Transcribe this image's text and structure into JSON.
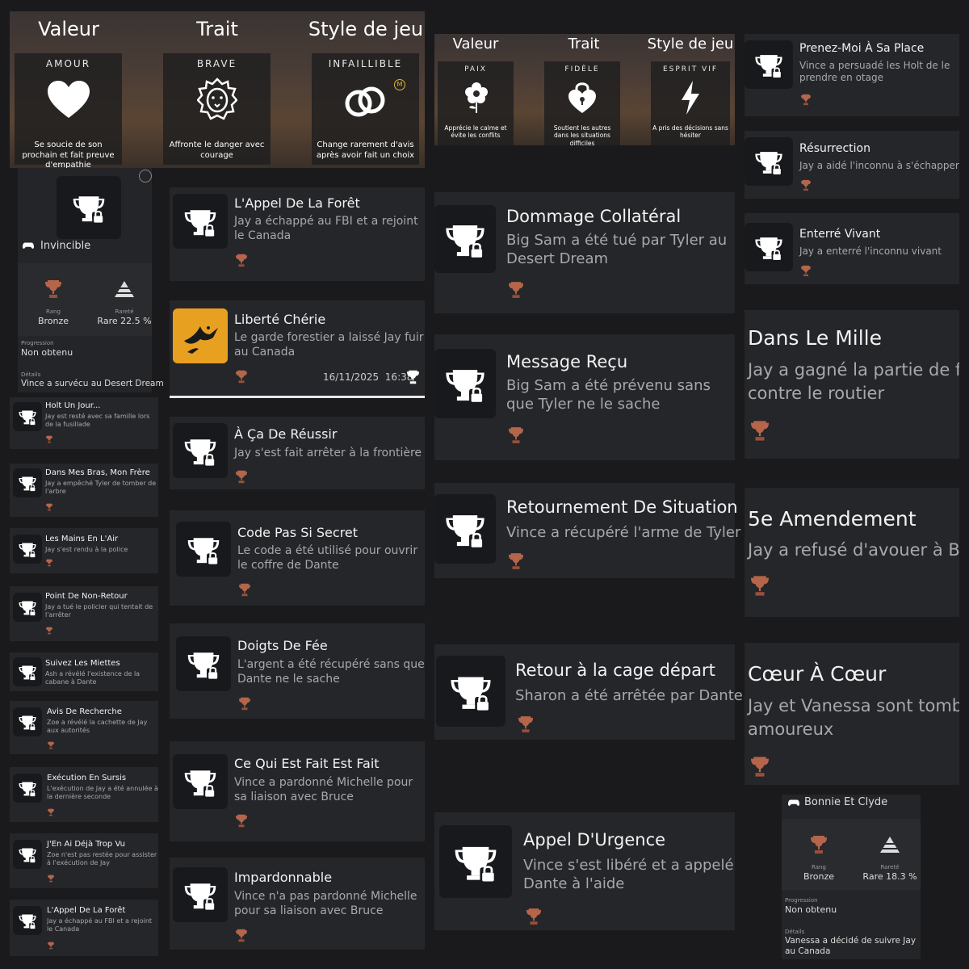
{
  "header1": {
    "cols": [
      "Valeur",
      "Trait",
      "Style de jeu"
    ],
    "boxes": [
      {
        "name": "AMOUR",
        "icon": "heart-icon",
        "desc": "Se soucie de son prochain et fait preuve d'empathie"
      },
      {
        "name": "BRAVE",
        "icon": "lion-icon",
        "desc": "Affronte le danger avec courage"
      },
      {
        "name": "INFAILLIBLE",
        "icon": "rings-icon",
        "badge": "M",
        "desc": "Change rarement d'avis après avoir fait un choix"
      }
    ]
  },
  "header2": {
    "cols": [
      "Valeur",
      "Trait",
      "Style de jeu"
    ],
    "boxes": [
      {
        "name": "PAIX",
        "icon": "flower-icon",
        "desc": "Apprécie le calme et évite les conflits"
      },
      {
        "name": "FIDÈLE",
        "icon": "lock-heart-icon",
        "desc": "Soutient les autres dans les situations difficiles"
      },
      {
        "name": "ESPRIT VIF",
        "icon": "lightning-icon",
        "desc": "A pris des décisions sans hésiter"
      }
    ]
  },
  "detail1": {
    "title": "Invincible",
    "rank_label": "Rang",
    "rank": "Bronze",
    "rarity_label": "Rareté",
    "rarity": "Rare 22.5 %",
    "progress_label": "Progression",
    "progress": "Non obtenu",
    "details_label": "Détails",
    "details": "Vince a survécu au Desert Dream"
  },
  "detail2": {
    "title": "Bonnie Et Clyde",
    "rank_label": "Rang",
    "rank": "Bronze",
    "rarity_label": "Rareté",
    "rarity": "Rare 18.3 %",
    "progress_label": "Progression",
    "progress": "Non obtenu",
    "details_label": "Détails",
    "details": "Vanessa a décidé de suivre Jay au Canada"
  },
  "col1": [
    {
      "title": "Holt Un Jour...",
      "desc": "Jay est resté avec sa famille lors de la fusillade"
    },
    {
      "title": "Dans Mes Bras, Mon Frère",
      "desc": "Jay a empêché Tyler de tomber de l'arbre"
    },
    {
      "title": "Les Mains En L'Air",
      "desc": "Jay s'est rendu à la police"
    },
    {
      "title": "Point De Non-Retour",
      "desc": "Jay a tué le policier qui tentait de l'arrêter"
    },
    {
      "title": "Suivez Les Miettes",
      "desc": "Ash a révélé l'existence de la cabane à Dante"
    },
    {
      "title": "Avis De Recherche",
      "desc": "Zoe a révélé la cachette de Jay aux autorités"
    },
    {
      "title": "Exécution En Sursis",
      "desc": "L'exécution de Jay a été annulée à la dernière seconde"
    },
    {
      "title": "J'En Ai Déjà Trop Vu",
      "desc": "Zoe n'est pas restée pour assister à l'exécution de Jay"
    },
    {
      "title": "L'Appel De La Forêt",
      "desc": "Jay a échappé au FBI et a rejoint le Canada"
    }
  ],
  "col2": [
    {
      "title": "L'Appel De La Forêt",
      "desc": "Jay a échappé au FBI et a rejoint le Canada"
    },
    {
      "title": "Liberté Chérie",
      "desc": "Le garde forestier a laissé Jay fuir au Canada",
      "date": "16/11/2025  16:38",
      "unlocked": true
    },
    {
      "title": "À Ça De Réussir",
      "desc": "Jay s'est fait arrêter à la frontière"
    },
    {
      "title": "Code Pas Si Secret",
      "desc": "Le code a été utilisé pour ouvrir le coffre de Dante"
    },
    {
      "title": "Doigts De Fée",
      "desc": "L'argent a été récupéré sans que Dante ne le sache"
    },
    {
      "title": "Ce Qui Est Fait Est Fait",
      "desc": "Vince a pardonné Michelle pour sa liaison avec Bruce"
    },
    {
      "title": "Impardonnable",
      "desc": "Vince n'a pas pardonné Michelle pour sa liaison avec Bruce"
    }
  ],
  "col3": [
    {
      "title": "Dommage Collatéral",
      "desc": "Big Sam a été tué par Tyler au Desert Dream"
    },
    {
      "title": "Message Reçu",
      "desc": "Big Sam a été prévenu sans que Tyler ne le sache"
    },
    {
      "title": "Retournement De Situation",
      "desc": "Vince a récupéré l'arme de Tyler"
    },
    {
      "title": "Retour à la cage départ",
      "desc": "Sharon a été arrêtée par Dante"
    },
    {
      "title": "Appel D'Urgence",
      "desc": "Vince s'est libéré et a appelé Dante à l'aide"
    }
  ],
  "col4": [
    {
      "title": "Prenez-Moi À Sa Place",
      "desc": "Vince a persuadé les Holt de le prendre en otage"
    },
    {
      "title": "Résurrection",
      "desc": "Jay a aidé l'inconnu à s'échapper"
    },
    {
      "title": "Enterré Vivant",
      "desc": "Jay a enterré l'inconnu vivant"
    },
    {
      "title": "Dans Le Mille",
      "desc": "Jay a gagné la partie de f contre le routier"
    },
    {
      "title": "5e Amendement",
      "desc": "Jay a refusé d'avouer à B"
    },
    {
      "title": "Cœur À Cœur",
      "desc": "Jay et Vanessa sont tomb amoureux"
    }
  ],
  "colors": {
    "bronze": "#b5654a",
    "panel": "#242528",
    "bg": "#1a1a1c"
  }
}
